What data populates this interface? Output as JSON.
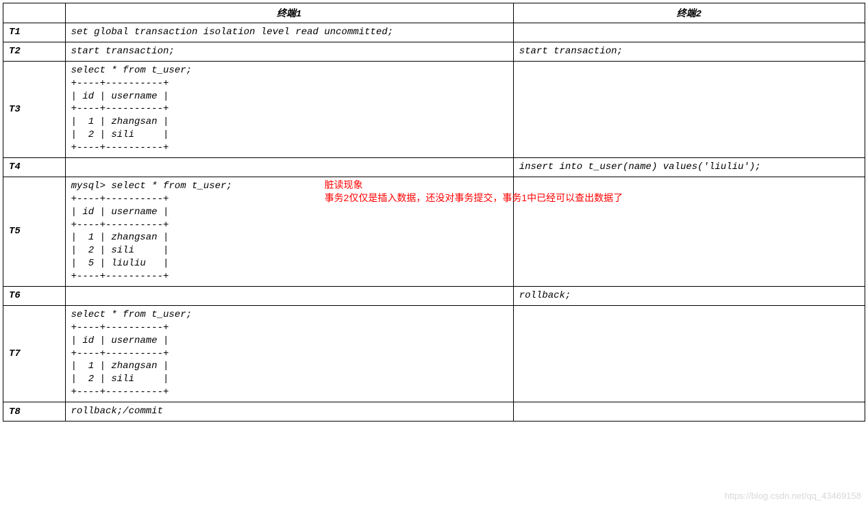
{
  "headers": {
    "col0": "",
    "col1": "终端1",
    "col2": "终端2"
  },
  "rows": [
    {
      "label": "T1",
      "t1": "set global transaction isolation level read uncommitted;",
      "t2": ""
    },
    {
      "label": "T2",
      "t1": "start transaction;",
      "t2": "start transaction;"
    },
    {
      "label": "T3",
      "t1": "select * from t_user;\n+----+----------+\n| id | username |\n+----+----------+\n|  1 | zhangsan |\n|  2 | sili     |\n+----+----------+",
      "t2": ""
    },
    {
      "label": "T4",
      "t1": "",
      "t2": "insert into t_user(name) values('liuliu');"
    },
    {
      "label": "T5",
      "t1": "mysql> select * from t_user;\n+----+----------+\n| id | username |\n+----+----------+\n|  1 | zhangsan |\n|  2 | sili     |\n|  5 | liuliu   |\n+----+----------+",
      "t2": "",
      "annotation": "脏读现象\n事务2仅仅是插入数据，还没对事务提交，事务1中已经可以查出数据了"
    },
    {
      "label": "T6",
      "t1": "",
      "t2": "rollback;"
    },
    {
      "label": "T7",
      "t1": "select * from t_user;\n+----+----------+\n| id | username |\n+----+----------+\n|  1 | zhangsan |\n|  2 | sili     |\n+----+----------+",
      "t2": ""
    },
    {
      "label": "T8",
      "t1": "rollback;/commit",
      "t2": ""
    }
  ],
  "watermark": "https://blog.csdn.net/qq_43469158"
}
